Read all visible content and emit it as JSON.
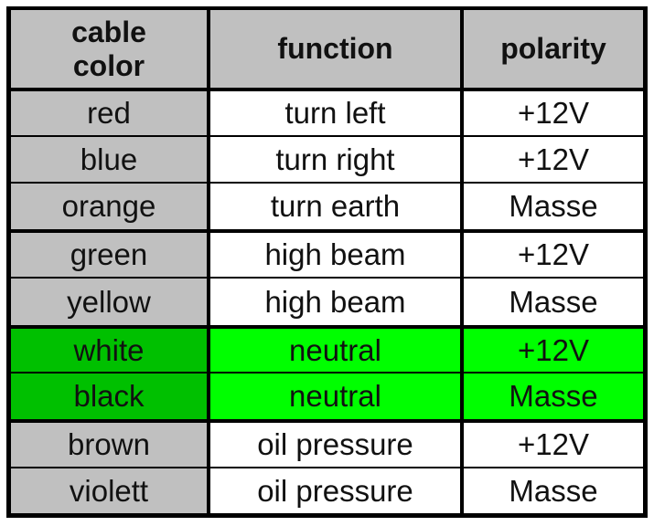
{
  "table": {
    "headers": [
      "cable\ncolor",
      "function",
      "polarity"
    ],
    "header_lines": [
      [
        "cable",
        "color"
      ],
      [
        "function"
      ],
      [
        "polarity"
      ]
    ],
    "rows": [
      {
        "cable_color": "red",
        "function": "turn left",
        "polarity": "+12V",
        "highlight": false
      },
      {
        "cable_color": "blue",
        "function": "turn right",
        "polarity": "+12V",
        "highlight": false
      },
      {
        "cable_color": "orange",
        "function": "turn earth",
        "polarity": "Masse",
        "highlight": false
      },
      {
        "cable_color": "green",
        "function": "high beam",
        "polarity": "+12V",
        "highlight": false
      },
      {
        "cable_color": "yellow",
        "function": "high beam",
        "polarity": "Masse",
        "highlight": false
      },
      {
        "cable_color": "white",
        "function": "neutral",
        "polarity": "+12V",
        "highlight": true
      },
      {
        "cable_color": "black",
        "function": "neutral",
        "polarity": "Masse",
        "highlight": true
      },
      {
        "cable_color": "brown",
        "function": "oil pressure",
        "polarity": "+12V",
        "highlight": false
      },
      {
        "cable_color": "violett",
        "function": "oil pressure",
        "polarity": "Masse",
        "highlight": false
      }
    ]
  },
  "colors": {
    "header_bg": "#c0c0c0",
    "first_col_bg": "#c0c0c0",
    "body_bg": "#ffffff",
    "highlight_first_col_bg": "#00c000",
    "highlight_bg": "#00ff00",
    "border": "#000000"
  }
}
